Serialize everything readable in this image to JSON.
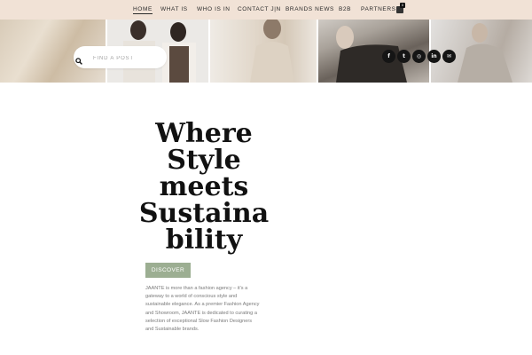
{
  "nav": {
    "items": [
      {
        "label": "HOME",
        "active": true
      },
      {
        "label": "WHAT IS",
        "active": false
      },
      {
        "label": "WHO IS IN",
        "active": false
      },
      {
        "label": "CONTACT J|N",
        "active": false
      },
      {
        "label": "BRANDS NEWS",
        "active": false
      },
      {
        "label": "B2B",
        "active": false
      },
      {
        "label": "PARTNERS",
        "active": false
      }
    ],
    "cart_icon": "cart-icon",
    "cart_count": "0"
  },
  "hero": {
    "search": {
      "placeholder": "FIND A POST",
      "value": "",
      "icon": "search-icon"
    },
    "social": [
      {
        "icon": "facebook-icon",
        "glyph": "f"
      },
      {
        "icon": "twitter-icon",
        "glyph": "t"
      },
      {
        "icon": "instagram-icon",
        "glyph": "◎"
      },
      {
        "icon": "linkedin-icon",
        "glyph": "in"
      },
      {
        "icon": "email-icon",
        "glyph": "✉"
      }
    ]
  },
  "main": {
    "headline_lines": [
      "Where",
      "Style",
      "meets",
      "Sustaina",
      "bility"
    ],
    "discover_label": "DISCOVER",
    "description": "JAANTE is more than a fashion agency – it's a gateway to a world of conscious style and sustainable elegance. As a premier Fashion Agency and Showroom, JAANTE is dedicated to curating a selection of exceptional Slow Fashion Designers and Sustainable brands."
  },
  "colors": {
    "nav_bg": "#f1e2d6",
    "accent_green": "#9cae92",
    "social_bg": "#151515",
    "text": "#111111"
  }
}
